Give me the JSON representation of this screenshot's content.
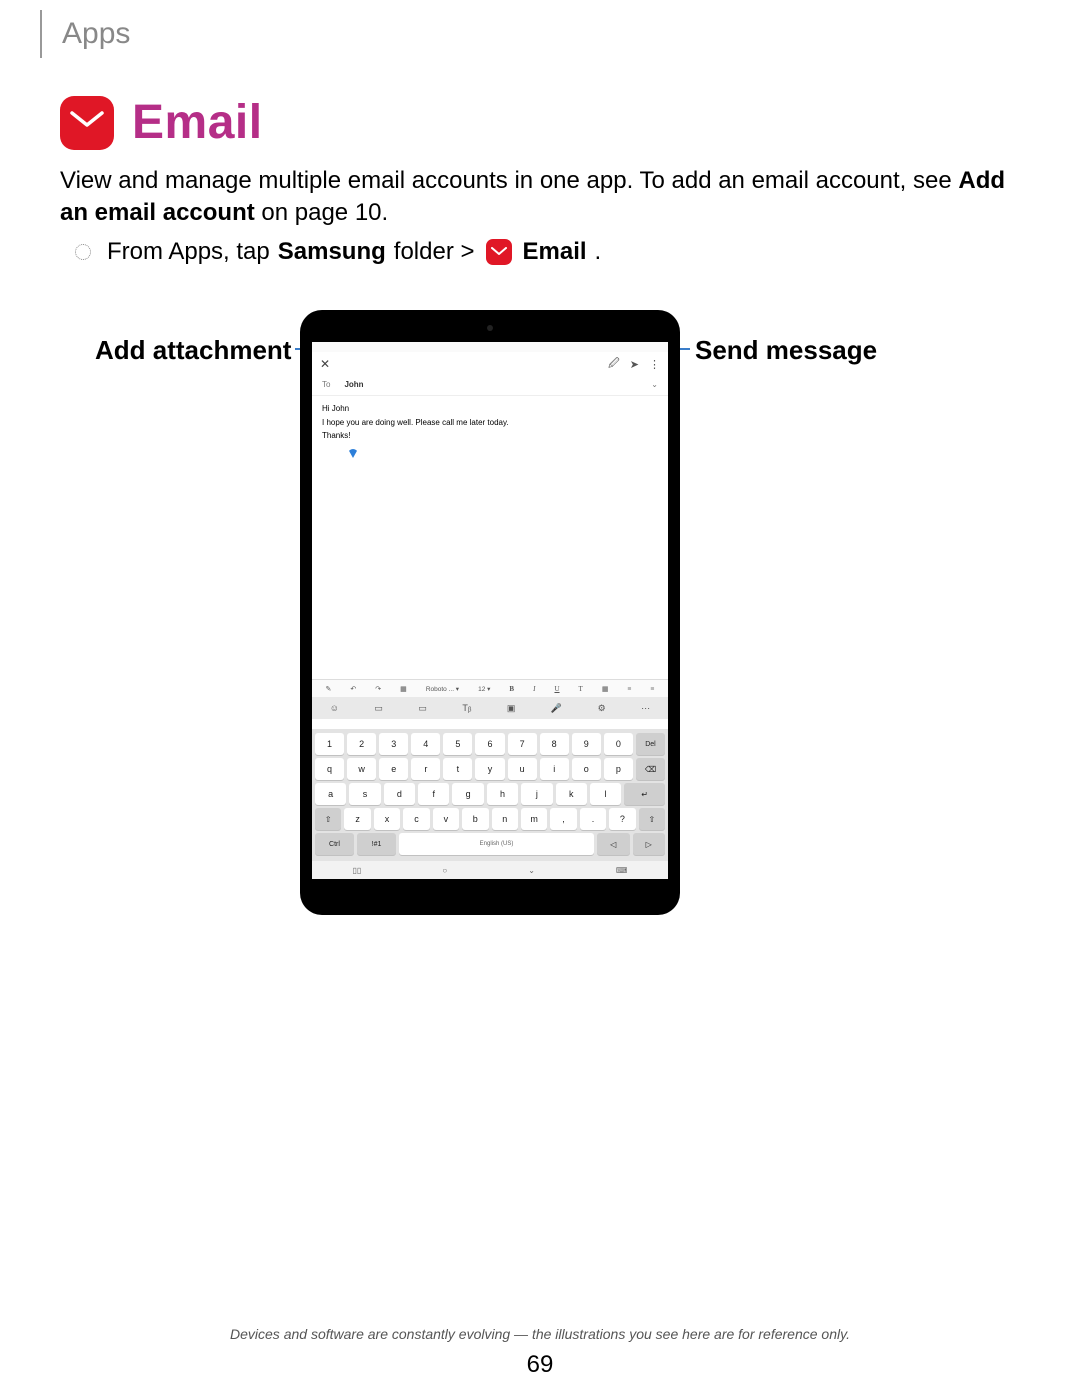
{
  "breadcrumb": "Apps",
  "section": {
    "title": "Email",
    "description_part1": "View and manage multiple email accounts in one app. To add an email account, see ",
    "description_bold": "Add an email account",
    "description_part2": " on page 10."
  },
  "instruction": {
    "prefix": "From Apps, tap ",
    "samsung": "Samsung",
    "folder_arrow": " folder > ",
    "email": "Email",
    "suffix": "."
  },
  "callouts": {
    "left": "Add attachment",
    "right": "Send message"
  },
  "compose": {
    "to_label": "To",
    "to_name": "John",
    "line1": "Hi John",
    "line2": "I hope you are doing well. Please call me later today.",
    "line3": "Thanks!"
  },
  "format_bar": {
    "font": "Roboto ... ▾",
    "size": "12 ▾",
    "bold": "B",
    "italic": "I",
    "underline": "U",
    "color": "T"
  },
  "keyboard": {
    "lang": "English (US)",
    "row1": [
      "1",
      "2",
      "3",
      "4",
      "5",
      "6",
      "7",
      "8",
      "9",
      "0",
      "Del"
    ],
    "row2": [
      "q",
      "w",
      "e",
      "r",
      "t",
      "y",
      "u",
      "i",
      "o",
      "p",
      "⌫"
    ],
    "row3": [
      "a",
      "s",
      "d",
      "f",
      "g",
      "h",
      "j",
      "k",
      "l",
      "↵"
    ],
    "row4": [
      "⇧",
      "z",
      "x",
      "c",
      "v",
      "b",
      "n",
      "m",
      ",",
      ".",
      "?",
      "⇧"
    ],
    "row5": [
      "Ctrl",
      "!#1",
      "",
      "◁",
      "▷"
    ]
  },
  "footnote": "Devices and software are constantly evolving — the illustrations you see here are for reference only.",
  "page_number": "69"
}
